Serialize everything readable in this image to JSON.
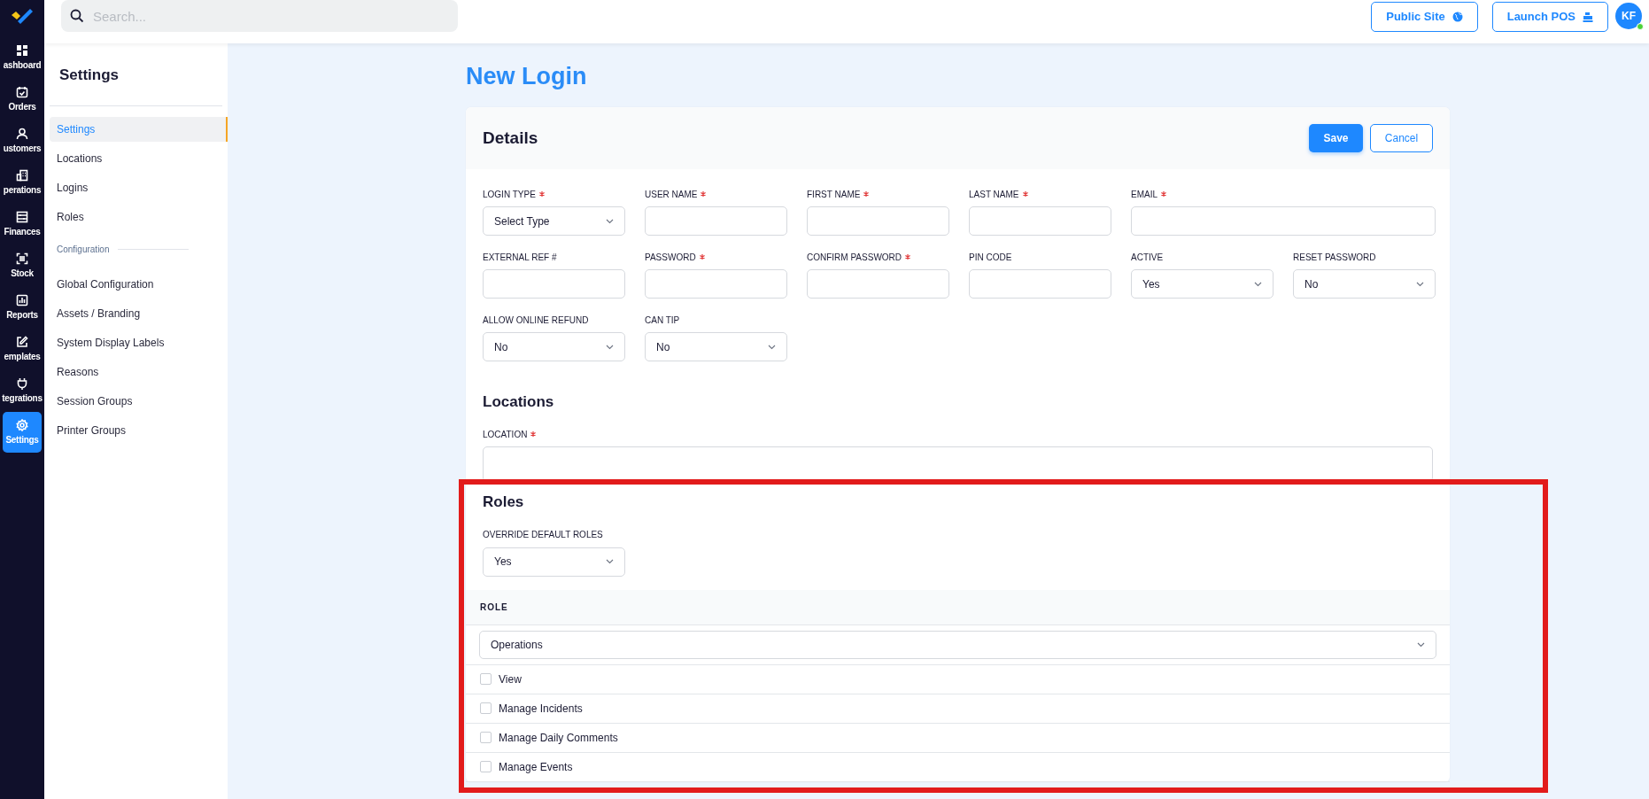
{
  "rail": {
    "items": [
      {
        "label": "ashboard",
        "selected": false
      },
      {
        "label": "Orders",
        "selected": false
      },
      {
        "label": "ustomers",
        "selected": false
      },
      {
        "label": "perations",
        "selected": false
      },
      {
        "label": "Finances",
        "selected": false
      },
      {
        "label": "Stock",
        "selected": false
      },
      {
        "label": "Reports",
        "selected": false
      },
      {
        "label": "emplates",
        "selected": false
      },
      {
        "label": "tegrations",
        "selected": false
      },
      {
        "label": "Settings",
        "selected": true
      }
    ]
  },
  "topbar": {
    "search": {
      "placeholder": "Search..."
    },
    "buttons": [
      {
        "label": "Public Site"
      },
      {
        "label": "Launch POS"
      }
    ],
    "avatar": {
      "initials": "KF",
      "online": true
    }
  },
  "sidebar": {
    "title": "Settings",
    "items": [
      {
        "label": "Settings",
        "selected": true
      },
      {
        "label": "Locations",
        "selected": false
      },
      {
        "label": "Logins",
        "selected": false
      },
      {
        "label": "Roles",
        "selected": false
      }
    ],
    "section": "Configuration",
    "section_items": [
      {
        "label": "Global Configuration",
        "selected": false
      },
      {
        "label": "Assets / Branding",
        "selected": false
      },
      {
        "label": "System Display Labels",
        "selected": false
      },
      {
        "label": "Reasons",
        "selected": false
      },
      {
        "label": "Session Groups",
        "selected": false
      },
      {
        "label": "Printer Groups",
        "selected": false
      }
    ]
  },
  "page_title": "New Login",
  "details": {
    "title": "Details",
    "save": "Save",
    "cancel": "Cancel",
    "rows": [
      [
        {
          "label": "LOGIN TYPE",
          "required": true,
          "kind": "select",
          "value": "Select Type"
        },
        {
          "label": "USER NAME",
          "required": true,
          "kind": "input"
        },
        {
          "label": "FIRST NAME",
          "required": true,
          "kind": "input"
        },
        {
          "label": "LAST NAME",
          "required": true,
          "kind": "input"
        },
        {
          "label": "EMAIL",
          "required": true,
          "kind": "input",
          "wide": true
        }
      ],
      [
        {
          "label": "EXTERNAL REF #",
          "required": false,
          "kind": "input"
        },
        {
          "label": "PASSWORD",
          "required": true,
          "kind": "input"
        },
        {
          "label": "CONFIRM PASSWORD",
          "required": true,
          "kind": "input"
        },
        {
          "label": "PIN CODE",
          "required": false,
          "kind": "input"
        },
        {
          "label": "ACTIVE",
          "required": false,
          "kind": "select",
          "value": "Yes"
        },
        {
          "label": "RESET PASSWORD",
          "required": false,
          "kind": "select",
          "value": "No"
        }
      ],
      [
        {
          "label": "ALLOW ONLINE REFUND",
          "required": false,
          "kind": "select",
          "value": "No"
        },
        {
          "label": "CAN TIP",
          "required": false,
          "kind": "select",
          "value": "No"
        }
      ]
    ]
  },
  "locations": {
    "title": "Locations",
    "field": {
      "label": "LOCATION",
      "required": true
    }
  },
  "roles": {
    "title": "Roles",
    "override": {
      "label": "OVERRIDE DEFAULT ROLES",
      "value": "Yes"
    },
    "table_header": "ROLE",
    "group": "Operations",
    "permissions": [
      {
        "label": "View",
        "checked": false
      },
      {
        "label": "Manage Incidents",
        "checked": false
      },
      {
        "label": "Manage Daily Comments",
        "checked": false
      },
      {
        "label": "Manage Events",
        "checked": false
      }
    ]
  },
  "highlight": {
    "color": "#e21b1b"
  }
}
